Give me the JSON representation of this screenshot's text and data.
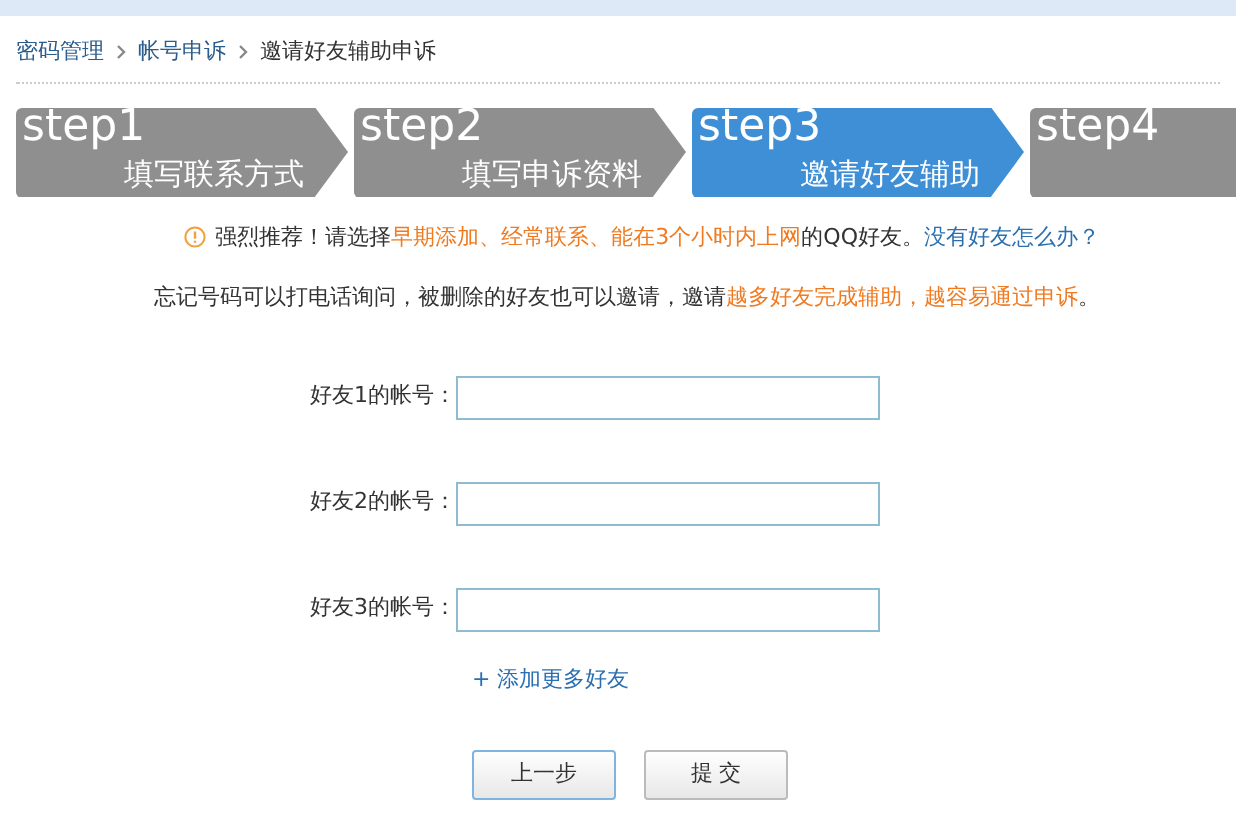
{
  "breadcrumb": [
    {
      "label": "密码管理",
      "kind": "link"
    },
    {
      "label": "帐号申诉",
      "kind": "link"
    },
    {
      "label": "邀请好友辅助申诉",
      "kind": "current"
    }
  ],
  "steps": [
    {
      "step": "step1",
      "label": "填写联系方式",
      "selected": false
    },
    {
      "step": "step2",
      "label": "填写申诉资料",
      "selected": false
    },
    {
      "step": "step3",
      "label": "邀请好友辅助",
      "selected": true
    },
    {
      "step": "step4",
      "selected": false
    }
  ],
  "notice": [
    {
      "kind": "plain",
      "text": "强烈推荐！请选择"
    },
    {
      "kind": "highlight",
      "text": "早期添加、经常联系、能在3个小时内上网"
    },
    {
      "kind": "plain",
      "text": "的QQ好友。"
    },
    {
      "kind": "link",
      "text": "没有好友怎么办？"
    }
  ],
  "tip": [
    {
      "kind": "plain",
      "text": "忘记号码可以打电话询问，被删除的好友也可以邀请，邀请"
    },
    {
      "kind": "highlight",
      "text": "越多好友完成辅助，越容易通过申诉"
    },
    {
      "kind": "plain",
      "text": "。"
    }
  ],
  "fields": [
    {
      "label": "好友1的帐号："
    },
    {
      "label": "好友2的帐号："
    },
    {
      "label": "好友3的帐号："
    }
  ],
  "add_more": "+ 添加更多好友",
  "buttons": [
    {
      "label": "上一步",
      "selected": true
    },
    {
      "label": "提 交",
      "selected": false
    }
  ]
}
